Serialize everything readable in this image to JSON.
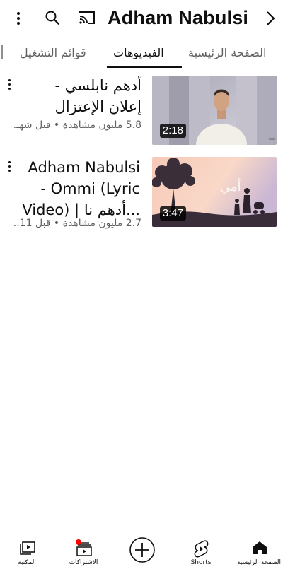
{
  "header": {
    "channel_name": "Adham Nabulsi"
  },
  "tabs": [
    {
      "label": "الصفحة الرئيسية"
    },
    {
      "label": "الفيديوهات"
    },
    {
      "label": "قوائم التشغيل"
    }
  ],
  "videos": [
    {
      "title": "أدهم نابلسي -\nإعلان الإعتزال",
      "meta": "5.8 مليون مشاهدة • قبل شهـ...",
      "duration": "2:18"
    },
    {
      "title": "Adham Nabulsi\n- Ommi (Lyric\nVideo) | أدهم نا...",
      "meta": "2.7 مليون مشاهدة • قبل 11...",
      "duration": "3:47"
    }
  ],
  "bottom_nav": {
    "home": "الصفحة الرئيسية",
    "shorts": "Shorts",
    "subscriptions": "الاشتراكات",
    "library": "المكتبة"
  },
  "colors": {
    "text_primary": "#0f0f0f",
    "text_secondary": "#606060",
    "notification_dot": "#ff0000"
  }
}
